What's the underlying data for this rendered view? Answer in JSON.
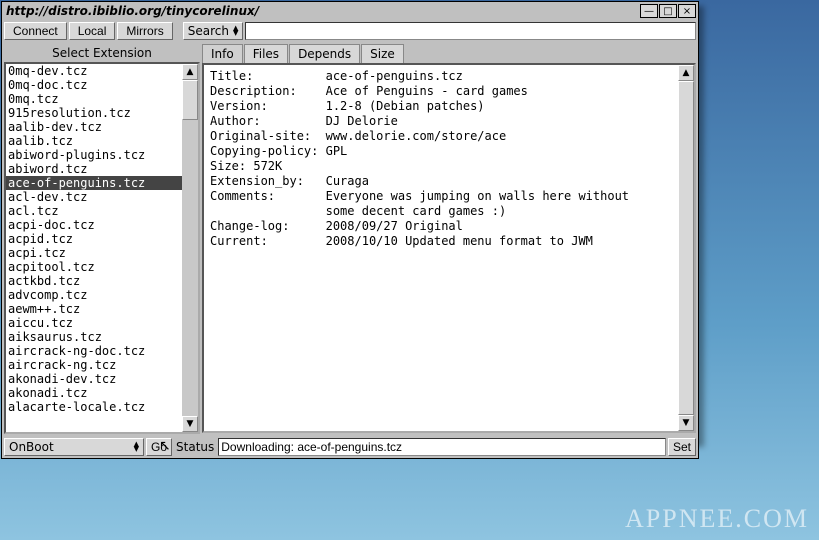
{
  "window": {
    "url": "http://distro.ibiblio.org/tinycorelinux/"
  },
  "toolbar": {
    "connect": "Connect",
    "local": "Local",
    "mirrors": "Mirrors",
    "search": "Search",
    "search_value": ""
  },
  "left": {
    "header": "Select Extension",
    "selected_index": 7,
    "items": [
      "0mq-dev.tcz",
      "0mq-doc.tcz",
      "0mq.tcz",
      "915resolution.tcz",
      "aalib-dev.tcz",
      "aalib.tcz",
      "abiword-plugins.tcz",
      "abiword.tcz",
      "ace-of-penguins.tcz",
      "acl-dev.tcz",
      "acl.tcz",
      "acpi-doc.tcz",
      "acpid.tcz",
      "acpi.tcz",
      "acpitool.tcz",
      "actkbd.tcz",
      "advcomp.tcz",
      "aewm++.tcz",
      "aiccu.tcz",
      "aiksaurus.tcz",
      "aircrack-ng-doc.tcz",
      "aircrack-ng.tcz",
      "akonadi-dev.tcz",
      "akonadi.tcz",
      "alacarte-locale.tcz"
    ]
  },
  "tabs": {
    "items": [
      "Info",
      "Files",
      "Depends",
      "Size"
    ],
    "active": 0
  },
  "info": {
    "fields": [
      {
        "label": "Title:",
        "value": "ace-of-penguins.tcz"
      },
      {
        "label": "Description:",
        "value": "Ace of Penguins - card games"
      },
      {
        "label": "Version:",
        "value": "1.2-8 (Debian patches)"
      },
      {
        "label": "Author:",
        "value": "DJ Delorie"
      },
      {
        "label": "Original-site:",
        "value": "www.delorie.com/store/ace"
      },
      {
        "label": "Copying-policy:",
        "value": "GPL"
      },
      {
        "label": "Size: 572K",
        "value": ""
      },
      {
        "label": "Extension_by:",
        "value": "Curaga"
      },
      {
        "label": "Comments:",
        "value": "Everyone was jumping on walls here without"
      },
      {
        "label": "",
        "value": "some decent card games :)"
      },
      {
        "label": "Change-log:",
        "value": "2008/09/27 Original"
      },
      {
        "label": "Current:",
        "value": "2008/10/10 Updated menu format to JWM"
      }
    ]
  },
  "bottom": {
    "mode": "OnBoot",
    "go": "Go",
    "status_label": "Status",
    "status_value": "Downloading: ace-of-penguins.tcz",
    "set": "Set"
  },
  "watermark": "APPNEE.COM"
}
